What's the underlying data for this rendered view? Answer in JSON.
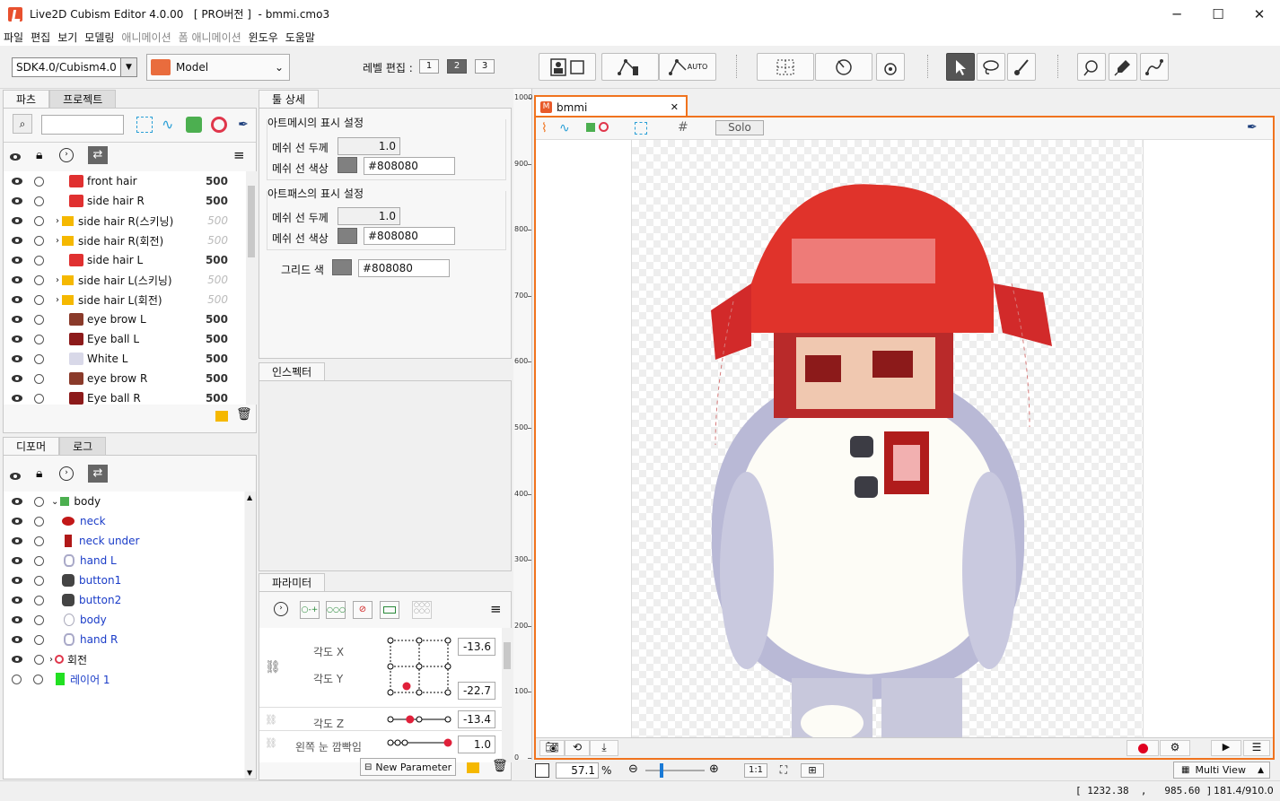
{
  "window": {
    "title": "Live2D Cubism Editor 4.0.00   [ PRO버전 ]  - bmmi.cmo3",
    "minimize": "─",
    "maximize": "☐",
    "close": "✕"
  },
  "menu": [
    {
      "label": "파일",
      "enabled": true
    },
    {
      "label": "편집",
      "enabled": true
    },
    {
      "label": "보기",
      "enabled": true
    },
    {
      "label": "모델링",
      "enabled": true
    },
    {
      "label": "애니메이션",
      "enabled": false
    },
    {
      "label": "폼 애니메이션",
      "enabled": false
    },
    {
      "label": "윈도우",
      "enabled": true
    },
    {
      "label": "도움말",
      "enabled": true
    }
  ],
  "toolbar": {
    "sdk_select": "SDK4.0/Cubism4.0",
    "mode_select": "Model",
    "level_label": "레벨 편집 :",
    "levels": [
      "1",
      "2",
      "3"
    ],
    "active_level": "2",
    "auto_label": "AUTO"
  },
  "parts_panel": {
    "tabs": [
      "파츠",
      "프로젝트"
    ],
    "rows": [
      {
        "name": "front hair",
        "value": "500",
        "folder": false,
        "dim": false
      },
      {
        "name": "side hair R",
        "value": "500",
        "folder": false,
        "dim": false
      },
      {
        "name": "side hair R(스키닝)",
        "value": "500",
        "folder": true,
        "dim": true
      },
      {
        "name": "side hair R(회전)",
        "value": "500",
        "folder": true,
        "dim": true
      },
      {
        "name": "side hair L",
        "value": "500",
        "folder": false,
        "dim": false
      },
      {
        "name": "side hair L(스키닝)",
        "value": "500",
        "folder": true,
        "dim": true
      },
      {
        "name": "side hair L(회전)",
        "value": "500",
        "folder": true,
        "dim": true
      },
      {
        "name": "eye brow L",
        "value": "500",
        "folder": false,
        "dim": false
      },
      {
        "name": "Eye ball L",
        "value": "500",
        "folder": false,
        "dim": false
      },
      {
        "name": "White L",
        "value": "500",
        "folder": false,
        "dim": false
      },
      {
        "name": "eye brow R",
        "value": "500",
        "folder": false,
        "dim": false
      },
      {
        "name": "Eye ball R",
        "value": "500",
        "folder": false,
        "dim": false
      }
    ]
  },
  "deformer_panel": {
    "tabs": [
      "디포머",
      "로그"
    ],
    "root": "body",
    "children": [
      "neck",
      "neck under",
      "hand L",
      "button1",
      "button2",
      "body",
      "hand R"
    ],
    "rotation": "회전",
    "layer": "레이어 1"
  },
  "tool_detail": {
    "tab": "툴 상세",
    "artmesh_header": "아트메시의 표시 설정",
    "artpath_header": "아트패스의 표시 설정",
    "mesh_line_width_label": "메쉬 선 두께",
    "mesh_line_color_label": "메쉬 선 색상",
    "mesh_width_value": "1.0",
    "mesh_color_value": "#808080",
    "path_width_value": "1.0",
    "path_color_value": "#808080",
    "grid_color_label": "그리드 색",
    "grid_color_value": "#808080",
    "swatch_color": "#808080"
  },
  "inspector": {
    "tab": "인스펙터"
  },
  "parameters": {
    "tab": "파라미터",
    "angle_x_label": "각도 X",
    "angle_y_label": "각도 Y",
    "angle_x_value": "-13.6",
    "angle_y_value": "-22.7",
    "angle_z_label": "각도 Z",
    "angle_z_value": "-13.4",
    "eye_open_label": "왼쪽 눈 깜빡임",
    "eye_open_value": "1.0",
    "angle_z_level": 0.34,
    "eye_open_level": 1.0,
    "new_param_button": "New Parameter"
  },
  "ruler": {
    "labels": [
      "1000",
      "900",
      "800",
      "700",
      "600",
      "500",
      "400",
      "300",
      "200",
      "100",
      "0"
    ]
  },
  "canvas": {
    "doc_tab": "bmmi",
    "solo_button": "Solo",
    "zoom_value": "57.1",
    "zoom_unit": "%",
    "ratio_button": "1:1",
    "multi_view": "Multi View",
    "accent_color": "#f0731e"
  },
  "status": {
    "cursor": "[ 1232.38  ,   985.60 ]",
    "coords": "181.4/910.0"
  }
}
